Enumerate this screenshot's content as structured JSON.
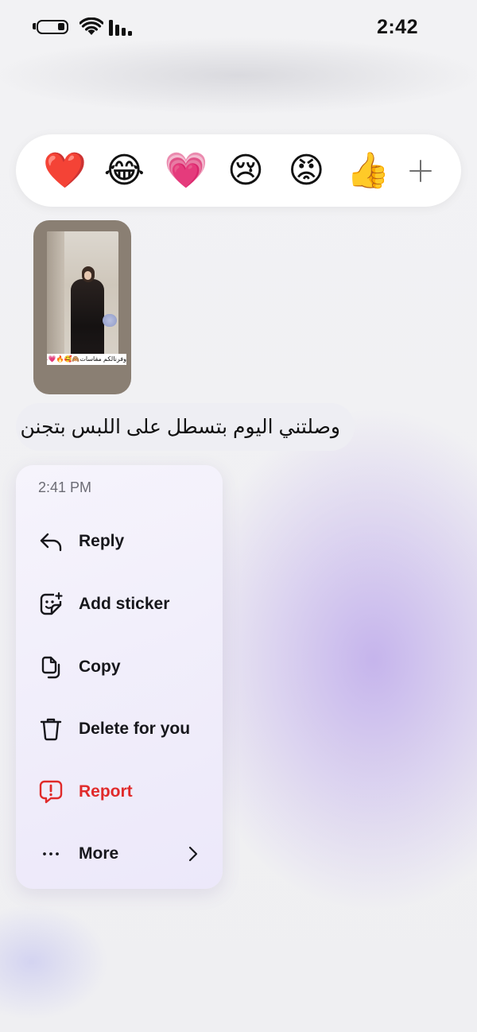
{
  "status_bar": {
    "time": "2:42"
  },
  "reactions": [
    {
      "name": "red-heart",
      "glyph": "❤️"
    },
    {
      "name": "tears-of-joy",
      "glyph": "😂"
    },
    {
      "name": "growing-heart",
      "glyph": "💗"
    },
    {
      "name": "crying-face",
      "glyph": "😢"
    },
    {
      "name": "angry-face",
      "glyph": "😡"
    },
    {
      "name": "thumbs-up",
      "glyph": "👍"
    }
  ],
  "story": {
    "caption": "وفرنالكم مقاسات🙈🥰🔥💗🍫"
  },
  "message": {
    "text": "وصلتني اليوم بتسطل على اللبس بتجنن"
  },
  "menu": {
    "timestamp": "2:41 PM",
    "items": [
      {
        "label": "Reply",
        "icon": "reply-icon"
      },
      {
        "label": "Add sticker",
        "icon": "sticker-icon"
      },
      {
        "label": "Copy",
        "icon": "copy-icon"
      },
      {
        "label": "Delete for you",
        "icon": "trash-icon"
      },
      {
        "label": "Report",
        "icon": "report-icon",
        "color": "#e02a2a"
      },
      {
        "label": "More",
        "icon": "more-icon"
      }
    ]
  }
}
